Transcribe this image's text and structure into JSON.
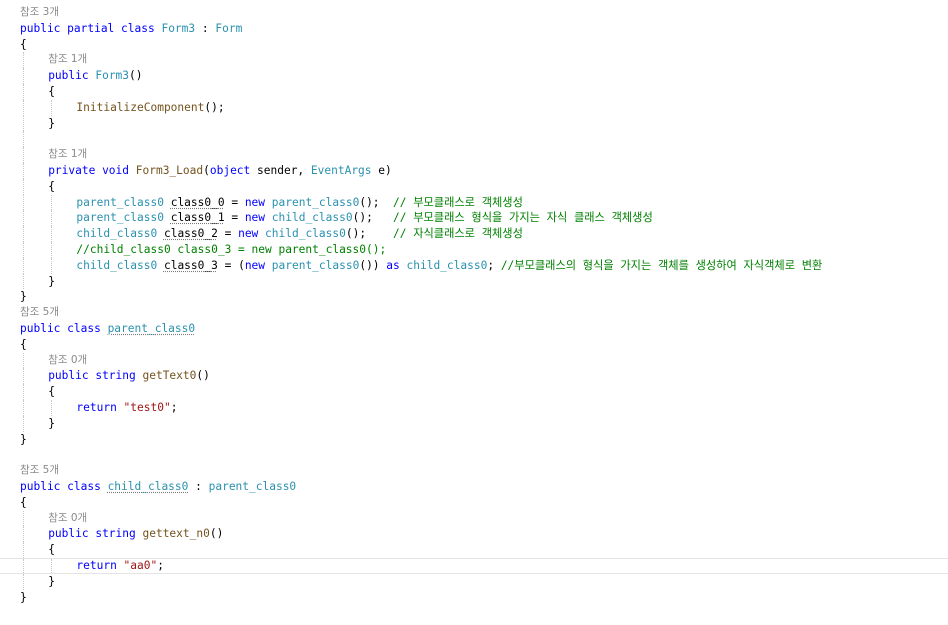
{
  "editor": {
    "lines": [
      {
        "indent": 0,
        "tokens": [
          {
            "c": "lens",
            "t": "참조 3개"
          }
        ]
      },
      {
        "indent": 0,
        "tokens": [
          {
            "c": "kw",
            "t": "public partial class "
          },
          {
            "c": "type",
            "t": "Form3"
          },
          {
            "c": "text",
            "t": " : "
          },
          {
            "c": "type",
            "t": "Form"
          }
        ]
      },
      {
        "indent": 0,
        "tokens": [
          {
            "c": "text",
            "t": "{"
          }
        ]
      },
      {
        "indent": 1,
        "tokens": [
          {
            "c": "lens",
            "t": "참조 1개"
          }
        ]
      },
      {
        "indent": 1,
        "tokens": [
          {
            "c": "kw",
            "t": "public "
          },
          {
            "c": "type",
            "t": "Form3"
          },
          {
            "c": "text",
            "t": "()"
          }
        ]
      },
      {
        "indent": 1,
        "tokens": [
          {
            "c": "text",
            "t": "{"
          }
        ]
      },
      {
        "indent": 2,
        "tokens": [
          {
            "c": "method",
            "t": "InitializeComponent"
          },
          {
            "c": "text",
            "t": "();"
          }
        ]
      },
      {
        "indent": 1,
        "tokens": [
          {
            "c": "text",
            "t": "}"
          }
        ]
      },
      {
        "indent": 1,
        "tokens": []
      },
      {
        "indent": 1,
        "tokens": [
          {
            "c": "lens",
            "t": "참조 1개"
          }
        ]
      },
      {
        "indent": 1,
        "tokens": [
          {
            "c": "kw",
            "t": "private void "
          },
          {
            "c": "method",
            "t": "Form3_Load"
          },
          {
            "c": "text",
            "t": "("
          },
          {
            "c": "kw",
            "t": "object"
          },
          {
            "c": "text",
            "t": " sender, "
          },
          {
            "c": "type",
            "t": "EventArgs"
          },
          {
            "c": "text",
            "t": " e)"
          }
        ]
      },
      {
        "indent": 1,
        "tokens": [
          {
            "c": "text",
            "t": "{"
          }
        ]
      },
      {
        "indent": 2,
        "tokens": [
          {
            "c": "type",
            "t": "parent_class0"
          },
          {
            "c": "text",
            "t": " "
          },
          {
            "c": "text",
            "t": "class0_0",
            "sq": true
          },
          {
            "c": "text",
            "t": " = "
          },
          {
            "c": "kw",
            "t": "new "
          },
          {
            "c": "type",
            "t": "parent_class0"
          },
          {
            "c": "text",
            "t": "();  "
          },
          {
            "c": "comment",
            "t": "// 부모클래스로 객체생성"
          }
        ]
      },
      {
        "indent": 2,
        "tokens": [
          {
            "c": "type",
            "t": "parent_class0"
          },
          {
            "c": "text",
            "t": " "
          },
          {
            "c": "text",
            "t": "class0_1",
            "sq": true
          },
          {
            "c": "text",
            "t": " = "
          },
          {
            "c": "kw",
            "t": "new "
          },
          {
            "c": "type",
            "t": "child_class0"
          },
          {
            "c": "text",
            "t": "();   "
          },
          {
            "c": "comment",
            "t": "// 부모클래스 형식을 가지는 자식 클래스 객체생성"
          }
        ]
      },
      {
        "indent": 2,
        "tokens": [
          {
            "c": "type",
            "t": "child_class0"
          },
          {
            "c": "text",
            "t": " "
          },
          {
            "c": "text",
            "t": "class0_2",
            "sq": true
          },
          {
            "c": "text",
            "t": " = "
          },
          {
            "c": "kw",
            "t": "new "
          },
          {
            "c": "type",
            "t": "child_class0"
          },
          {
            "c": "text",
            "t": "();    "
          },
          {
            "c": "comment",
            "t": "// 자식클래스로 객체생성"
          }
        ]
      },
      {
        "indent": 2,
        "tokens": [
          {
            "c": "comment",
            "t": "//child_class0 class0_3 = new parent_class0();"
          }
        ]
      },
      {
        "indent": 2,
        "tokens": [
          {
            "c": "type",
            "t": "child_class0"
          },
          {
            "c": "text",
            "t": " "
          },
          {
            "c": "text",
            "t": "class0_3",
            "sq": true
          },
          {
            "c": "text",
            "t": " = ("
          },
          {
            "c": "kw",
            "t": "new "
          },
          {
            "c": "type",
            "t": "parent_class0"
          },
          {
            "c": "text",
            "t": "()) "
          },
          {
            "c": "kw",
            "t": "as "
          },
          {
            "c": "type",
            "t": "child_class0"
          },
          {
            "c": "text",
            "t": "; "
          },
          {
            "c": "comment",
            "t": "//부모클래스의 형식을 가지는 객체를 생성하여 자식객체로 변환"
          }
        ]
      },
      {
        "indent": 1,
        "tokens": [
          {
            "c": "text",
            "t": "}"
          }
        ]
      },
      {
        "indent": 0,
        "tokens": [
          {
            "c": "text",
            "t": "}"
          }
        ]
      },
      {
        "indent": 0,
        "tokens": [
          {
            "c": "lens",
            "t": "참조 5개"
          }
        ]
      },
      {
        "indent": 0,
        "tokens": [
          {
            "c": "kw",
            "t": "public class "
          },
          {
            "c": "type",
            "t": "parent_class0",
            "sq": true
          }
        ]
      },
      {
        "indent": 0,
        "tokens": [
          {
            "c": "text",
            "t": "{"
          }
        ]
      },
      {
        "indent": 1,
        "tokens": [
          {
            "c": "lens",
            "t": "참조 0개"
          }
        ]
      },
      {
        "indent": 1,
        "tokens": [
          {
            "c": "kw",
            "t": "public string "
          },
          {
            "c": "method",
            "t": "getText0"
          },
          {
            "c": "text",
            "t": "()"
          }
        ]
      },
      {
        "indent": 1,
        "tokens": [
          {
            "c": "text",
            "t": "{"
          }
        ]
      },
      {
        "indent": 2,
        "tokens": [
          {
            "c": "kw",
            "t": "return "
          },
          {
            "c": "string",
            "t": "\"test0\""
          },
          {
            "c": "text",
            "t": ";"
          }
        ]
      },
      {
        "indent": 1,
        "tokens": [
          {
            "c": "text",
            "t": "}"
          }
        ]
      },
      {
        "indent": 0,
        "tokens": [
          {
            "c": "text",
            "t": "}"
          }
        ]
      },
      {
        "indent": 0,
        "tokens": []
      },
      {
        "indent": 0,
        "tokens": [
          {
            "c": "lens",
            "t": "참조 5개"
          }
        ]
      },
      {
        "indent": 0,
        "tokens": [
          {
            "c": "kw",
            "t": "public class "
          },
          {
            "c": "type",
            "t": "child_class0",
            "sq": true
          },
          {
            "c": "text",
            "t": " : "
          },
          {
            "c": "type",
            "t": "parent_class0"
          }
        ]
      },
      {
        "indent": 0,
        "tokens": [
          {
            "c": "text",
            "t": "{"
          }
        ]
      },
      {
        "indent": 1,
        "tokens": [
          {
            "c": "lens",
            "t": "참조 0개"
          }
        ]
      },
      {
        "indent": 1,
        "tokens": [
          {
            "c": "kw",
            "t": "public string "
          },
          {
            "c": "method",
            "t": "gettext_n0"
          },
          {
            "c": "text",
            "t": "()"
          }
        ]
      },
      {
        "indent": 1,
        "tokens": [
          {
            "c": "text",
            "t": "{"
          }
        ]
      },
      {
        "indent": 2,
        "current": true,
        "tokens": [
          {
            "c": "kw",
            "t": "return "
          },
          {
            "c": "string",
            "t": "\"aa0\""
          },
          {
            "c": "text",
            "t": ";"
          }
        ]
      },
      {
        "indent": 1,
        "tokens": [
          {
            "c": "text",
            "t": "}"
          }
        ]
      },
      {
        "indent": 0,
        "tokens": [
          {
            "c": "text",
            "t": "}"
          }
        ]
      }
    ]
  }
}
